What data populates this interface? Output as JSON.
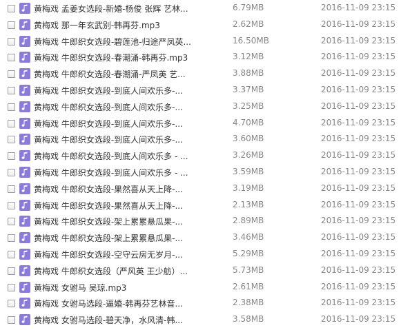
{
  "files": [
    {
      "name": "黄梅戏 孟姜女选段-新婚-杨俊 张辉 艺林...",
      "size": "6.79MB",
      "date": "2016-11-09 23:15",
      "icon": "music-file-icon"
    },
    {
      "name": "黄梅戏 那一年玄武别-韩再芬.mp3",
      "size": "2.62MB",
      "date": "2016-11-09 23:15",
      "icon": "music-file-icon"
    },
    {
      "name": "黄梅戏 牛郎织女选段-碧莲池-归途严凤英...",
      "size": "16.50MB",
      "date": "2016-11-09 23:15",
      "icon": "music-file-icon"
    },
    {
      "name": "黄梅戏 牛郎织女选段-春潮涌-韩再芬.mp3",
      "size": "3.12MB",
      "date": "2016-11-09 23:15",
      "icon": "music-file-icon"
    },
    {
      "name": "黄梅戏 牛郎织女选段-春潮涌-严凤英 艺...",
      "size": "3.88MB",
      "date": "2016-11-09 23:15",
      "icon": "music-file-icon"
    },
    {
      "name": "黄梅戏 牛郎织女选段-到底人间欢乐多-...",
      "size": "3.37MB",
      "date": "2016-11-09 23:15",
      "icon": "music-file-icon"
    },
    {
      "name": "黄梅戏 牛郎织女选段-到底人间欢乐多-...",
      "size": "3.25MB",
      "date": "2016-11-09 23:15",
      "icon": "music-file-icon"
    },
    {
      "name": "黄梅戏 牛郎织女选段-到底人间欢乐多-...",
      "size": "4.70MB",
      "date": "2016-11-09 23:15",
      "icon": "music-file-icon"
    },
    {
      "name": "黄梅戏 牛郎织女选段-到底人间欢乐多-...",
      "size": "3.60MB",
      "date": "2016-11-09 23:15",
      "icon": "music-file-icon"
    },
    {
      "name": "黄梅戏 牛郎织女选段-到底人间欢乐多 - ...",
      "size": "3.26MB",
      "date": "2016-11-09 23:15",
      "icon": "music-file-icon"
    },
    {
      "name": "黄梅戏 牛郎织女选段-到底人间欢乐多 - ...",
      "size": "3.59MB",
      "date": "2016-11-09 23:15",
      "icon": "music-file-icon"
    },
    {
      "name": "黄梅戏 牛郎织女选段-果然喜从天上降-...",
      "size": "3.19MB",
      "date": "2016-11-09 23:15",
      "icon": "music-file-icon"
    },
    {
      "name": "黄梅戏 牛郎织女选段-果然喜从天上降-...",
      "size": "2.13MB",
      "date": "2016-11-09 23:15",
      "icon": "music-file-icon"
    },
    {
      "name": "黄梅戏 牛郎织女选段-架上累累悬瓜果-...",
      "size": "2.89MB",
      "date": "2016-11-09 23:15",
      "icon": "music-file-icon"
    },
    {
      "name": "黄梅戏 牛郎织女选段-架上累累悬瓜果-...",
      "size": "3.46MB",
      "date": "2016-11-09 23:15",
      "icon": "music-file-icon"
    },
    {
      "name": "黄梅戏 牛郎织女选段-空守云房无岁月-...",
      "size": "5.29MB",
      "date": "2016-11-09 23:15",
      "icon": "music-file-icon"
    },
    {
      "name": "黄梅戏 牛郎织女选段（严风英 王少舫）...",
      "size": "5.73MB",
      "date": "2016-11-09 23:15",
      "icon": "music-file-icon"
    },
    {
      "name": "黄梅戏 女驸马 吴琼.mp3",
      "size": "2.61MB",
      "date": "2016-11-09 23:15",
      "icon": "music-file-icon"
    },
    {
      "name": "黄梅戏 女驸马选段-逼婚-韩再芬艺林音...",
      "size": "2.38MB",
      "date": "2016-11-09 23:15",
      "icon": "music-file-icon"
    },
    {
      "name": "黄梅戏 女驸马选段-碧天净，水风清-韩...",
      "size": "3.58MB",
      "date": "2016-11-09 23:15",
      "icon": "music-file-icon"
    }
  ],
  "colors": {
    "icon_bg": "#8b7ad8",
    "name_text": "#333333",
    "meta_text": "#888888",
    "checkbox_border": "#9a9a9a"
  }
}
